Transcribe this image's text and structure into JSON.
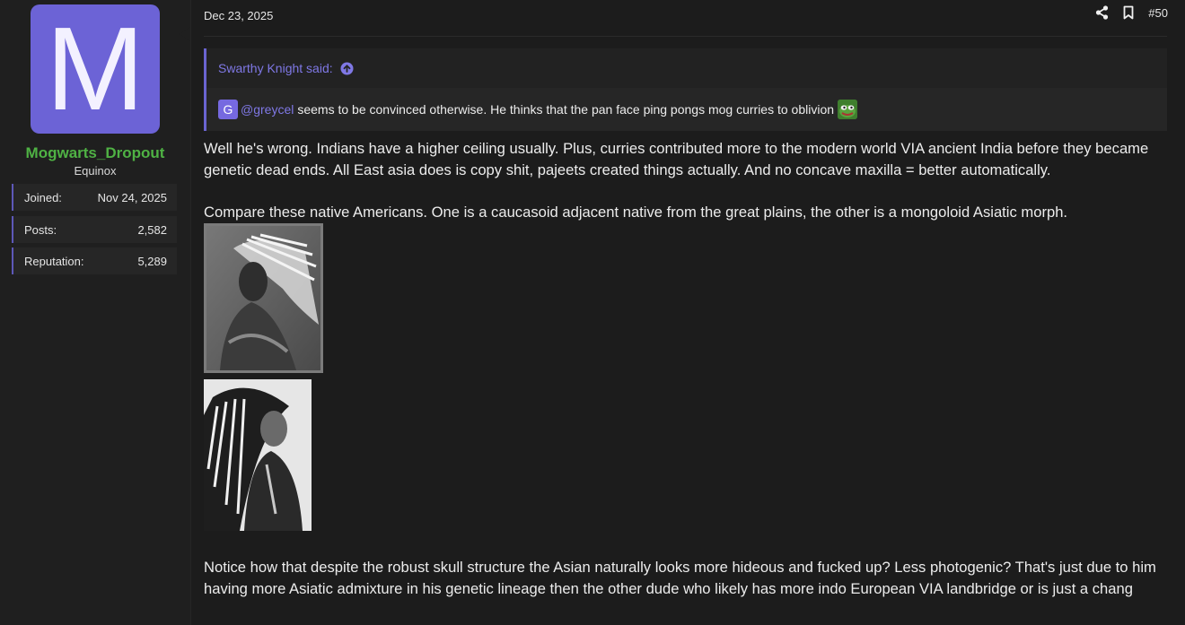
{
  "user": {
    "avatar_letter": "M",
    "avatar_color": "#6c63d6",
    "username": "Mogwarts_Dropout",
    "username_color": "#4fb244",
    "user_title": "Equinox",
    "stats": [
      {
        "label": "Joined:",
        "value": "Nov 24, 2025"
      },
      {
        "label": "Posts:",
        "value": "2,582"
      },
      {
        "label": "Reputation:",
        "value": "5,289"
      }
    ]
  },
  "post": {
    "date": "Dec 23, 2025",
    "number": "#50",
    "icons": [
      "share-icon",
      "bookmark-icon"
    ],
    "quote": {
      "author": "Swarthy Knight said:",
      "mention_badge": "G",
      "mention": "@greycel",
      "text": "seems to be convinced otherwise. He thinks that the pan face ping pongs mog curries to oblivion"
    },
    "paragraphs": [
      "Well he's wrong. Indians have a higher ceiling usually. Plus, curries contributed more to the modern world VIA ancient India before they became genetic dead ends. All East asia does is copy shit, pajeets created things actually. And no concave maxilla = better automatically.",
      "Compare these native Americans. One is a caucasoid adjacent native from the great plains, the other is a mongoloid Asiatic morph.",
      "Notice how that despite the robust skull structure the Asian naturally looks more hideous and fucked up? Less photogenic? That's just due to him having more Asiatic admixture in his genetic lineage then the other dude who likely has more indo European VIA landbridge or is just a chang"
    ],
    "accent_color": "#6a64d1"
  }
}
